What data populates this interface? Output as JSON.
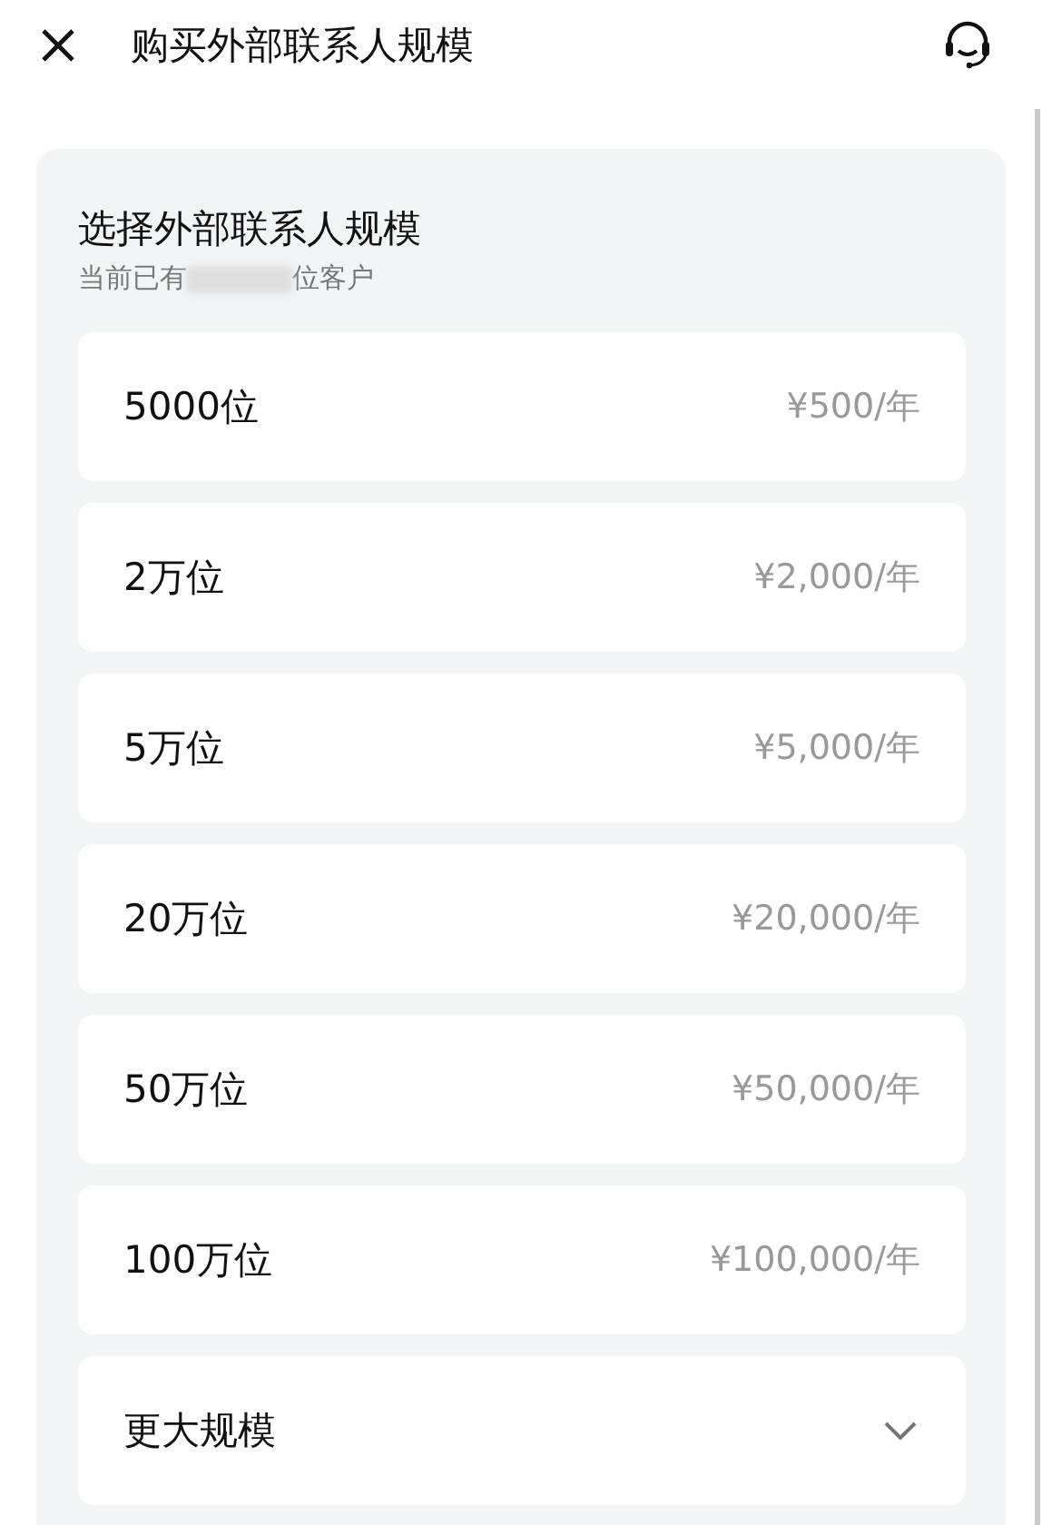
{
  "header": {
    "title": "购买外部联系人规模"
  },
  "card": {
    "title": "选择外部联系人规模",
    "subtitle_before": "当前已有",
    "subtitle_after": "位客户",
    "options": [
      {
        "kind": "price",
        "label": "5000位",
        "price": "¥500/年"
      },
      {
        "kind": "price",
        "label": "2万位",
        "price": "¥2,000/年"
      },
      {
        "kind": "price",
        "label": "5万位",
        "price": "¥5,000/年"
      },
      {
        "kind": "price",
        "label": "20万位",
        "price": "¥20,000/年"
      },
      {
        "kind": "price",
        "label": "50万位",
        "price": "¥50,000/年"
      },
      {
        "kind": "price",
        "label": "100万位",
        "price": "¥100,000/年"
      },
      {
        "kind": "expand",
        "label": "更大规模"
      }
    ]
  }
}
